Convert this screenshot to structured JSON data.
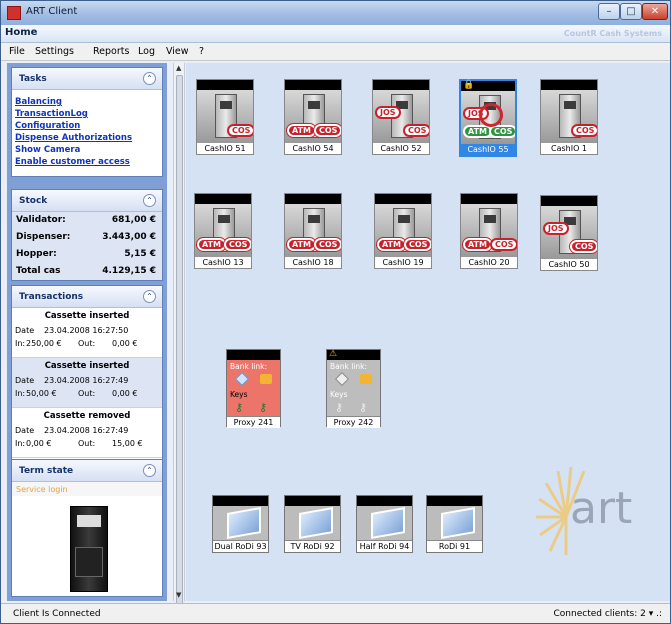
{
  "window": {
    "title": "ART Client",
    "min": "–",
    "max": "□",
    "close": "✕"
  },
  "tabbar": {
    "tab": "Home",
    "brand": "CountR Cash Systems"
  },
  "menu": [
    "File",
    "Settings",
    "Reports",
    "Log",
    "View",
    "?"
  ],
  "tasks": {
    "title": "Tasks",
    "items": [
      "Balancing",
      "TransactionLog",
      "Configuration",
      "Dispense Authorizations",
      "Show Camera",
      "Enable customer access"
    ]
  },
  "stock": {
    "title": "Stock",
    "rows": [
      {
        "k": "Validator:",
        "v": "681,00 €"
      },
      {
        "k": "Dispenser:",
        "v": "3.443,00 €"
      },
      {
        "k": "Hopper:",
        "v": "5,15 €"
      },
      {
        "k": "Total cas",
        "v": "4.129,15 €"
      }
    ]
  },
  "transactions": {
    "title": "Transactions",
    "items": [
      {
        "head": "Cassette inserted",
        "date_label": "Date",
        "date": "23.04.2008 16:27:50",
        "in_label": "In:",
        "in": "250,00 €",
        "out_label": "Out:",
        "out": "0,00 €"
      },
      {
        "head": "Cassette inserted",
        "date_label": "Date",
        "date": "23.04.2008 16:27:49",
        "in_label": "In:",
        "in": "50,00 €",
        "out_label": "Out:",
        "out": "0,00 €"
      },
      {
        "head": "Cassette removed",
        "date_label": "Date",
        "date": "23.04.2008 16:27:49",
        "in_label": "In:",
        "in": "0,00 €",
        "out_label": "Out:",
        "out": "15,00 €"
      }
    ]
  },
  "termstate": {
    "title": "Term state",
    "status": "Service login"
  },
  "tiles_row1": [
    "CashIO 51",
    "CashIO 54",
    "CashIO 52",
    "CashIO 55",
    "CashIO 1"
  ],
  "tiles_row2": [
    "CashIO 13",
    "CashIO 18",
    "CashIO 19",
    "CashIO 20",
    "CashIO 50"
  ],
  "badges": {
    "cos": "COS",
    "atm": "ATM",
    "jos": "JOS"
  },
  "proxies": [
    {
      "label": "Proxy 241",
      "bank": "Bank link:",
      "keys": "Keys"
    },
    {
      "label": "Proxy 242",
      "bank": "Bank link:",
      "keys": "Keys"
    }
  ],
  "rodis": [
    "Dual RoDi 93",
    "TV RoDi 92",
    "Half RoDi 94",
    "RoDi 91"
  ],
  "logo": "art",
  "status": {
    "left": "Client Is Connected",
    "right": "Connected clients: 2 ▾ .:"
  }
}
